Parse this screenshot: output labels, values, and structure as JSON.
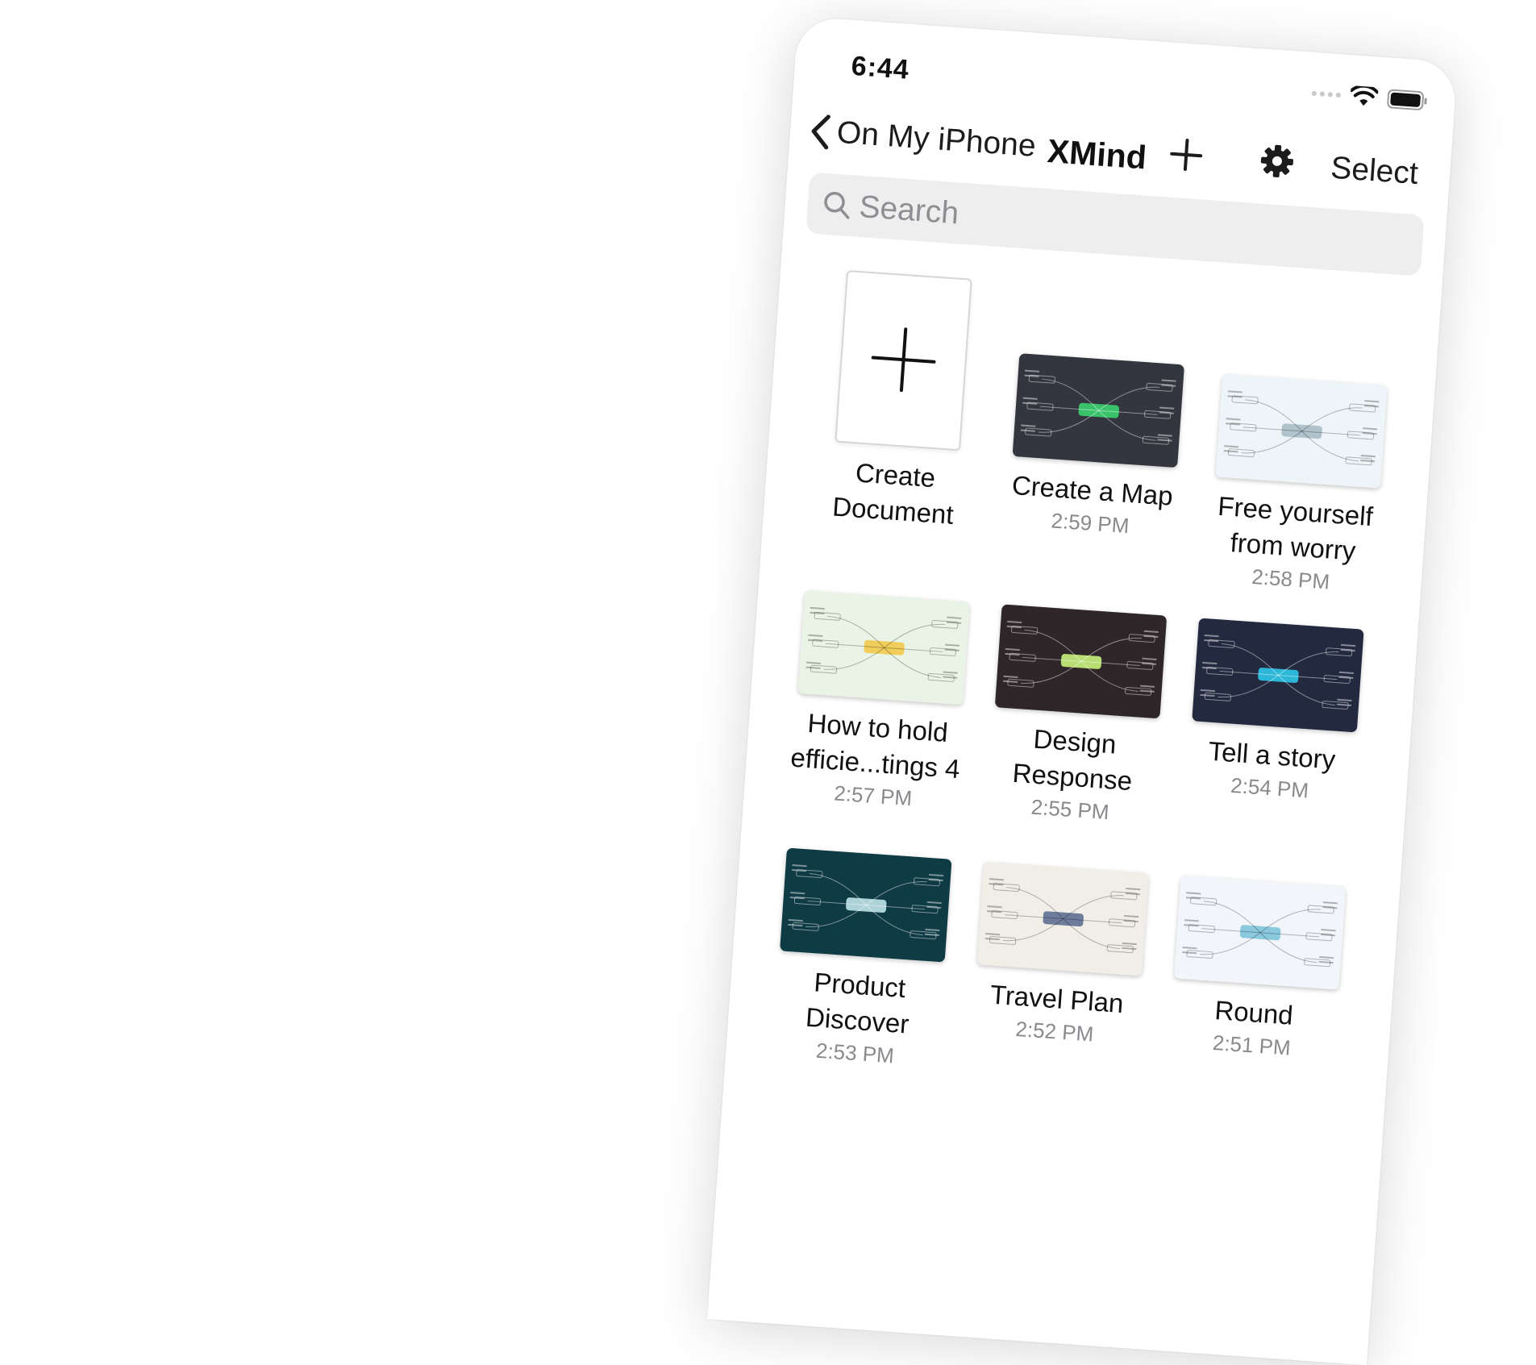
{
  "status_bar": {
    "time": "6:44"
  },
  "nav": {
    "back_label": "On My iPhone",
    "title": "XMind",
    "select_label": "Select",
    "add_icon": "plus-icon",
    "settings_icon": "gear-icon"
  },
  "search": {
    "placeholder": "Search",
    "value": ""
  },
  "create_tile": {
    "label": "Create Document"
  },
  "documents": [
    {
      "title": "Create a Map",
      "time": "2:59 PM",
      "theme": "dark-slate",
      "bg": "#34363f",
      "accent": "#3bd16f"
    },
    {
      "title": "Free yourself from worry",
      "time": "2:58 PM",
      "theme": "light-blue",
      "bg": "#eef5f8",
      "accent": "#a9bcc6"
    },
    {
      "title": "How to hold efficie...tings 4",
      "time": "2:57 PM",
      "theme": "light-green",
      "bg": "#eaf4e6",
      "accent": "#f2c94c"
    },
    {
      "title": "Design Response",
      "time": "2:55 PM",
      "theme": "dark-brown",
      "bg": "#2e2628",
      "accent": "#c8f27a"
    },
    {
      "title": "Tell a story",
      "time": "2:54 PM",
      "theme": "navy",
      "bg": "#232a40",
      "accent": "#2ec5e8"
    },
    {
      "title": "Product Discover",
      "time": "2:53 PM",
      "theme": "teal-dark",
      "bg": "#0f3b45",
      "accent": "#bfe3e8"
    },
    {
      "title": "Travel Plan",
      "time": "2:52 PM",
      "theme": "beige",
      "bg": "#f1eee8",
      "accent": "#5f6f94"
    },
    {
      "title": "Round",
      "time": "2:51 PM",
      "theme": "pale-blue",
      "bg": "#f2f6fa",
      "accent": "#7fc4dc"
    }
  ]
}
